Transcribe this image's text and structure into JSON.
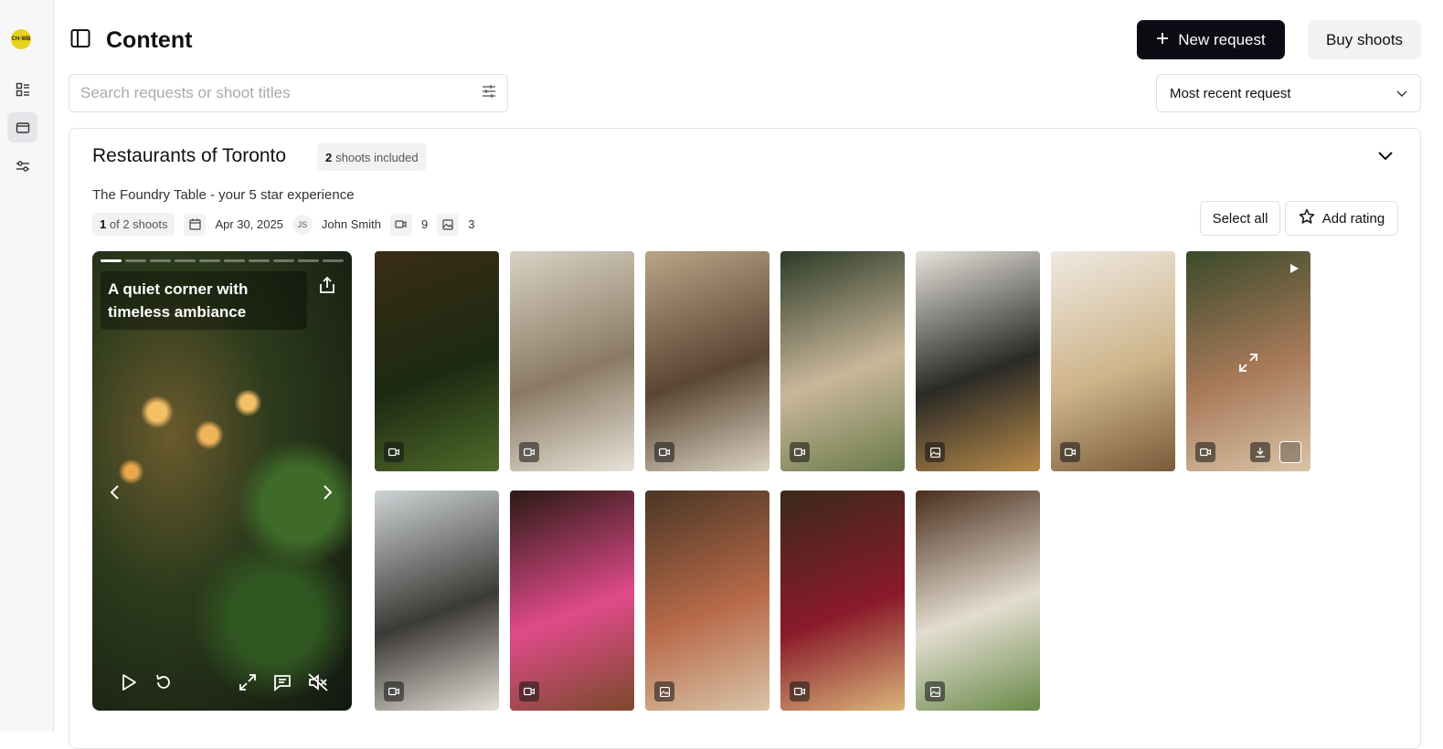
{
  "app": {
    "logo_text": "CH·WB"
  },
  "header": {
    "title": "Content",
    "new_request_label": "New request",
    "buy_shoots_label": "Buy shoots"
  },
  "search": {
    "placeholder": "Search requests or shoot titles",
    "value": ""
  },
  "sort": {
    "selected": "Most recent request"
  },
  "request": {
    "title": "Restaurants of Toronto",
    "shoots_count": "2",
    "shoots_badge_suffix": "shoots included",
    "shoot_title": "The Foundry Table - your 5 star experience",
    "shoot_index": "1",
    "shoot_index_of": "of 2 shoots",
    "date": "Apr 30, 2025",
    "author_initials": "JS",
    "author_name": "John Smith",
    "video_count": "9",
    "photo_count": "3",
    "select_all_label": "Select all",
    "add_rating_label": "Add rating"
  },
  "player": {
    "caption": "A quiet corner with timeless ambiance",
    "progress_segments": 10,
    "current_segment": 1
  },
  "gallery": [
    {
      "kind": "video",
      "scene": "string lights and ivy",
      "colors": [
        "#3a2c14",
        "#1d2a12",
        "#4f6b2a"
      ]
    },
    {
      "kind": "video",
      "scene": "people at buffet",
      "colors": [
        "#d9d2c3",
        "#8a7a64",
        "#e8e3d8"
      ]
    },
    {
      "kind": "video",
      "scene": "wine glasses on wooden table",
      "colors": [
        "#b9a586",
        "#5a4633",
        "#dcd3c2"
      ]
    },
    {
      "kind": "video",
      "scene": "overhead dinner table toast",
      "colors": [
        "#2c3a26",
        "#c9b79a",
        "#6a7a4a"
      ]
    },
    {
      "kind": "photo",
      "scene": "salmon dish with wine",
      "colors": [
        "#e7e4dc",
        "#2a2a26",
        "#b88a4a"
      ]
    },
    {
      "kind": "video",
      "scene": "woman eating burger",
      "colors": [
        "#efe9e1",
        "#cdb48a",
        "#7a5a3a"
      ]
    },
    {
      "kind": "video",
      "scene": "woman with chopsticks",
      "colors": [
        "#3a4a2a",
        "#a87a5a",
        "#d9c4a8"
      ],
      "hovered": true
    },
    {
      "kind": "video",
      "scene": "chef plating dishes",
      "colors": [
        "#cfd4d6",
        "#3c3a36",
        "#e5e0d8"
      ]
    },
    {
      "kind": "video",
      "scene": "man eating with pink shirt",
      "colors": [
        "#2a1a14",
        "#e04a8a",
        "#7a4a2a"
      ]
    },
    {
      "kind": "photo",
      "scene": "plated dessert on board",
      "colors": [
        "#4a3624",
        "#b86a4a",
        "#d9c4a8"
      ]
    },
    {
      "kind": "video",
      "scene": "red wine toast",
      "colors": [
        "#3a2a1a",
        "#8a1a2a",
        "#d9b47a"
      ]
    },
    {
      "kind": "photo",
      "scene": "overhead table with plates",
      "colors": [
        "#4a2e1c",
        "#e3ddd0",
        "#6a8a4a"
      ]
    }
  ]
}
